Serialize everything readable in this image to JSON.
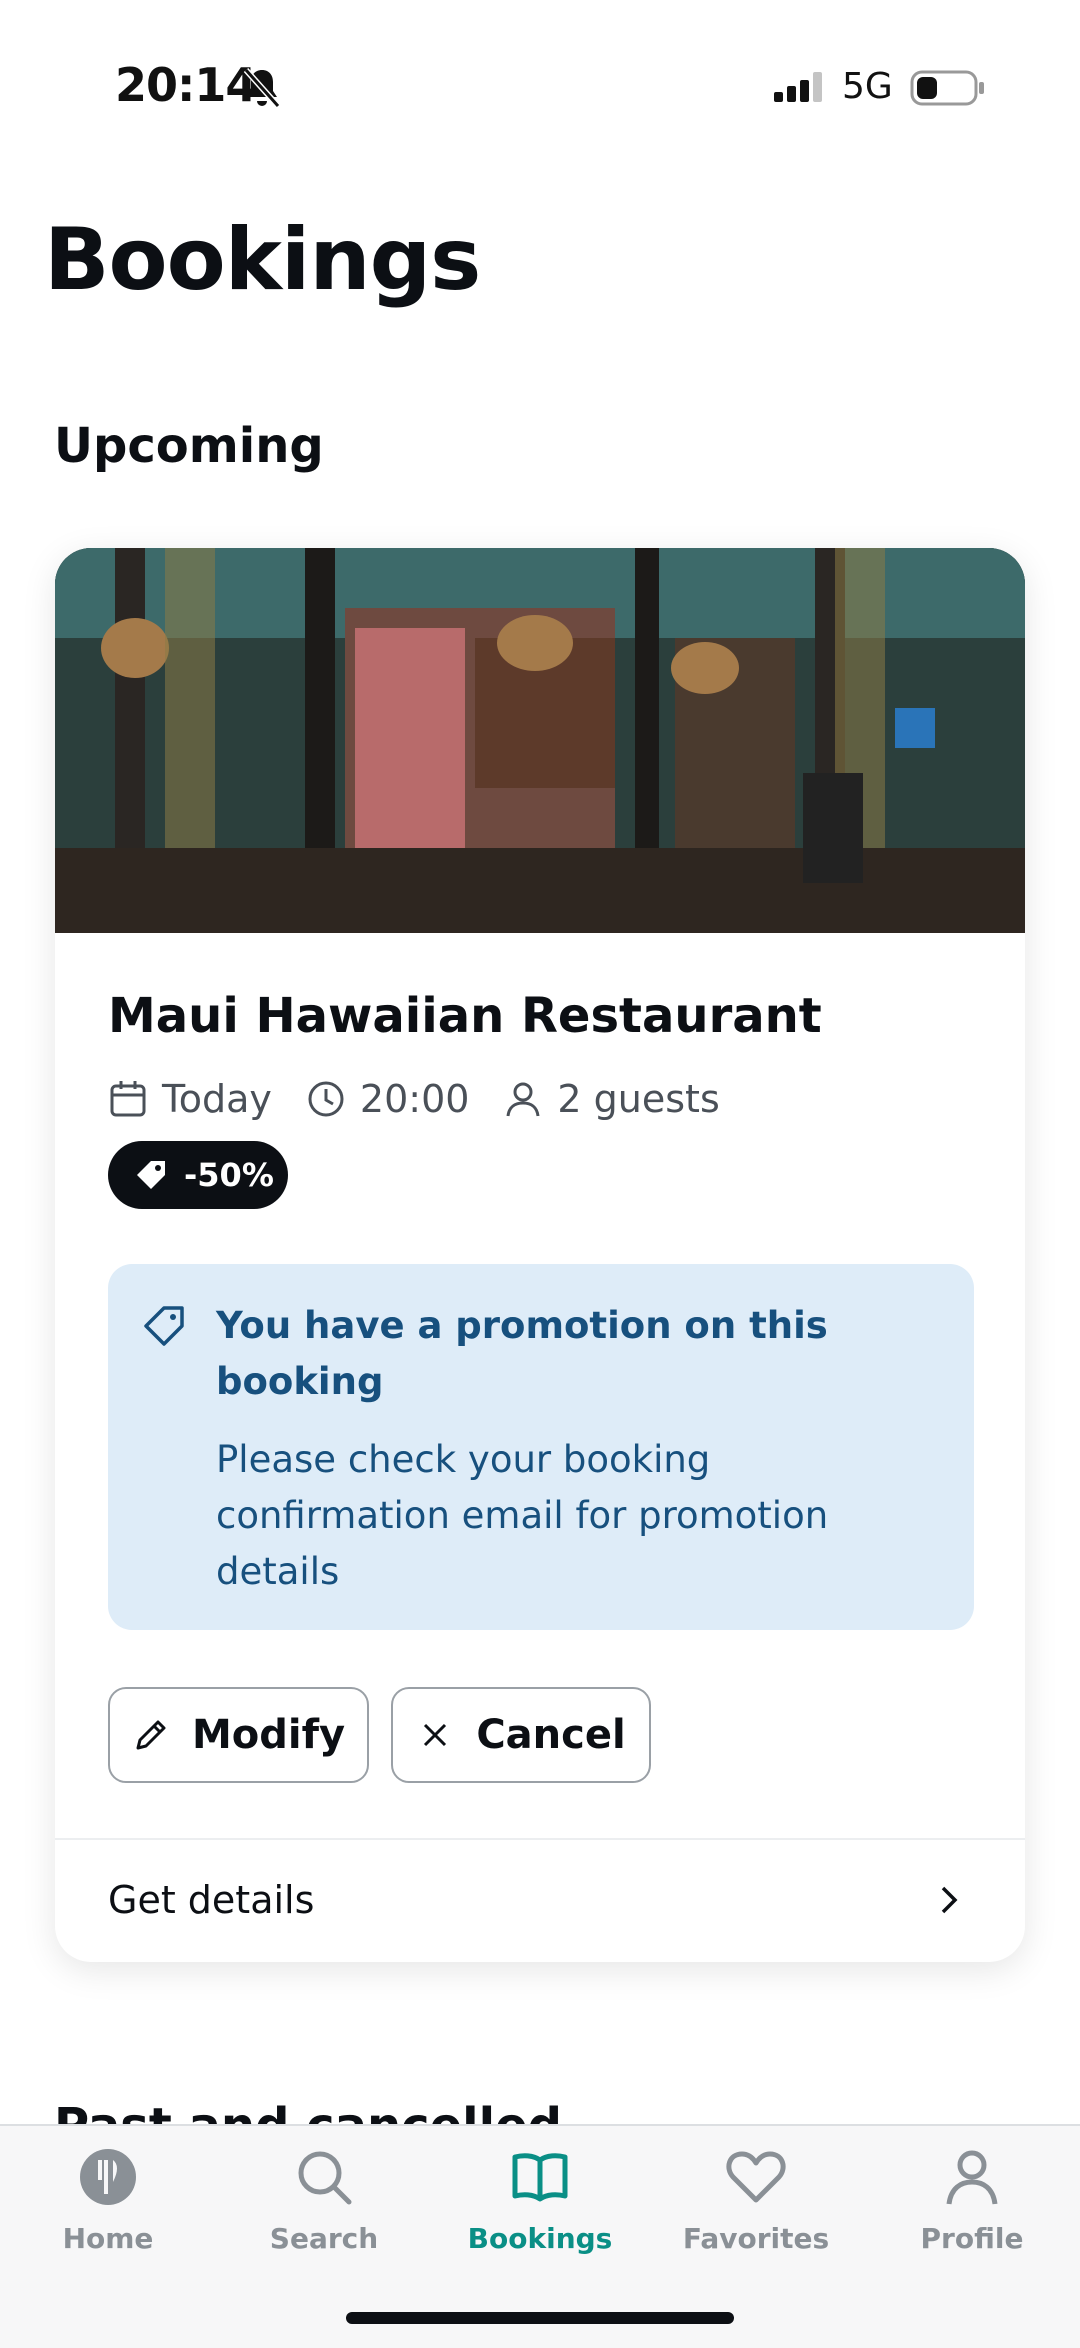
{
  "status_bar": {
    "time": "20:14",
    "network": "5G"
  },
  "page": {
    "title": "Bookings"
  },
  "upcoming": {
    "section_title": "Upcoming",
    "booking": {
      "restaurant_name": "Maui Hawaiian Restaurant",
      "date": "Today",
      "time": "20:00",
      "guests": "2 guests",
      "discount": "-50%",
      "promo_title": "You have a promotion on this booking",
      "promo_text": "Please check your booking confirmation email for promotion details",
      "modify_label": "Modify",
      "cancel_label": "Cancel",
      "details_label": "Get details"
    }
  },
  "past": {
    "section_title": "Past and cancelled"
  },
  "tab_bar": {
    "tabs": [
      {
        "label": "Home",
        "icon": "fork-knife-icon"
      },
      {
        "label": "Search",
        "icon": "search-icon"
      },
      {
        "label": "Bookings",
        "icon": "book-icon",
        "active": true
      },
      {
        "label": "Favorites",
        "icon": "heart-icon"
      },
      {
        "label": "Profile",
        "icon": "person-icon"
      }
    ]
  },
  "colors": {
    "accent": "#0a8f86",
    "promo_bg": "#deecf8",
    "promo_text": "#17507e",
    "dark": "#0c0f14"
  }
}
